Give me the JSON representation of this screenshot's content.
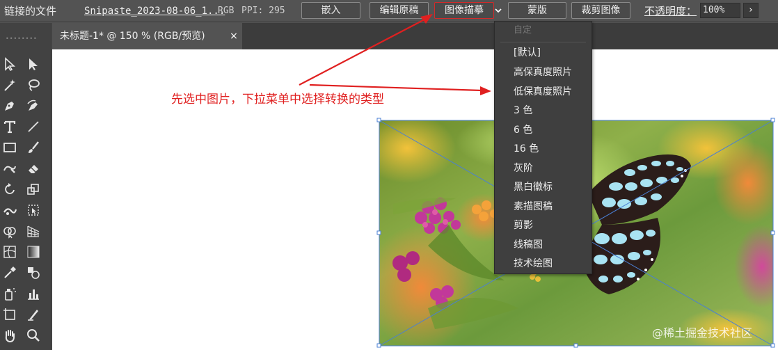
{
  "control_bar": {
    "linked_file_label": "链接的文件",
    "file_name": "Snipaste_2023-08-06_1...",
    "color_mode": "RGB",
    "ppi": "PPI: 295",
    "embed_button": "嵌入",
    "edit_original_button": "编辑原稿",
    "image_trace_button": "图像描摹",
    "mask_button": "蒙版",
    "crop_button": "裁剪图像",
    "opacity_label": "不透明度：",
    "opacity_value": "100%",
    "more_icon": "chevron-right-icon"
  },
  "document_tab": {
    "title": "未标题-1* @ 150 % (RGB/预览)",
    "close_glyph": "×"
  },
  "annotation": {
    "text": "先选中图片，下拉菜单中选择转换的类型",
    "color": "#e02020"
  },
  "trace_menu": {
    "header": "自定",
    "items": [
      "[默认]",
      "高保真度照片",
      "低保真度照片",
      "3 色",
      "6 色",
      "16 色",
      "灰阶",
      "黑白徽标",
      "素描图稿",
      "剪影",
      "线稿图",
      "技术绘图"
    ]
  },
  "watermark": "@稀土掘金技术社区",
  "tools": [
    "selection-tool-icon",
    "direct-selection-tool-icon",
    "magic-wand-tool-icon",
    "lasso-tool-icon",
    "pen-tool-icon",
    "curvature-tool-icon",
    "type-tool-icon",
    "line-tool-icon",
    "rectangle-tool-icon",
    "paintbrush-tool-icon",
    "shaper-tool-icon",
    "eraser-tool-icon",
    "rotate-tool-icon",
    "scale-tool-icon",
    "width-tool-icon",
    "free-transform-tool-icon",
    "shape-builder-tool-icon",
    "perspective-grid-tool-icon",
    "mesh-tool-icon",
    "gradient-tool-icon",
    "eyedropper-tool-icon",
    "blend-tool-icon",
    "symbol-sprayer-tool-icon",
    "column-graph-tool-icon",
    "artboard-tool-icon",
    "slice-tool-icon",
    "hand-tool-icon",
    "zoom-tool-icon"
  ],
  "colors": {
    "accent_red": "#d42a2a",
    "selection_blue": "#4a7fd4",
    "panel_bg": "#535353",
    "toolbox_bg": "#424242"
  }
}
